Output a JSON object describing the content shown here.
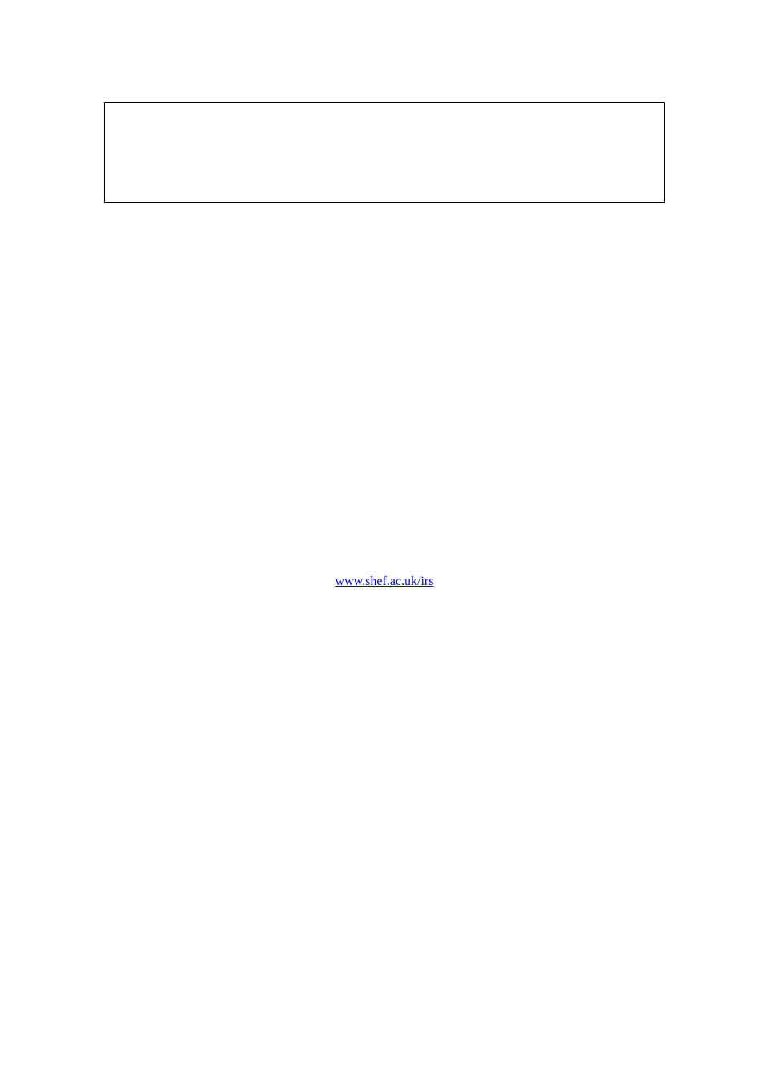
{
  "link_text": "www.shef.ac.uk/irs",
  "link_href": "http://www.shef.ac.uk/irs"
}
